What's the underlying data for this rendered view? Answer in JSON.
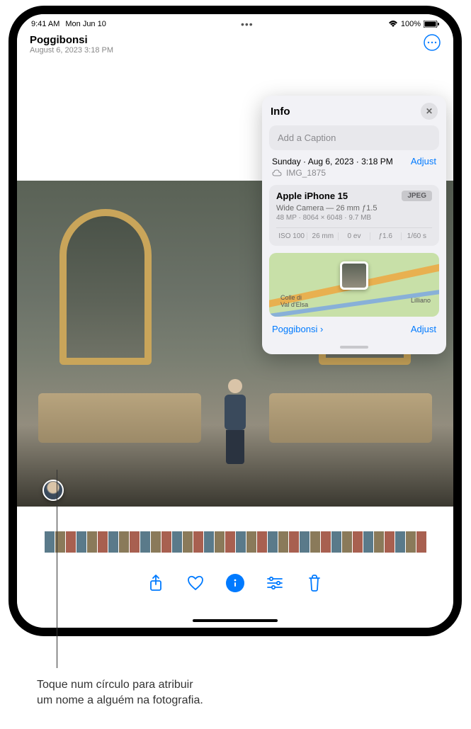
{
  "status": {
    "time": "9:41 AM",
    "date": "Mon Jun 10",
    "battery": "100%"
  },
  "header": {
    "location": "Poggibonsi",
    "subdate": "August 6, 2023  3:18 PM"
  },
  "info": {
    "title": "Info",
    "caption_placeholder": "Add a Caption",
    "date_line": "Sunday · Aug 6, 2023 · 3:18 PM",
    "adjust_label": "Adjust",
    "filename": "IMG_1875",
    "device": "Apple iPhone 15",
    "format_badge": "JPEG",
    "lens": "Wide Camera — 26 mm ƒ1.5",
    "meta": "48 MP · 8064 × 6048 · 9.7 MB",
    "exif": {
      "iso": "ISO 100",
      "focal": "26 mm",
      "ev": "0 ev",
      "aperture": "ƒ1.6",
      "shutter": "1/60 s"
    },
    "map": {
      "label_a": "Colle di\nVal d'Elsa",
      "label_b": "Lilliano",
      "place": "Poggibonsi",
      "adjust": "Adjust"
    }
  },
  "callout": {
    "line1": "Toque num círculo para atribuir",
    "line2": "um nome a alguém na fotografia."
  }
}
